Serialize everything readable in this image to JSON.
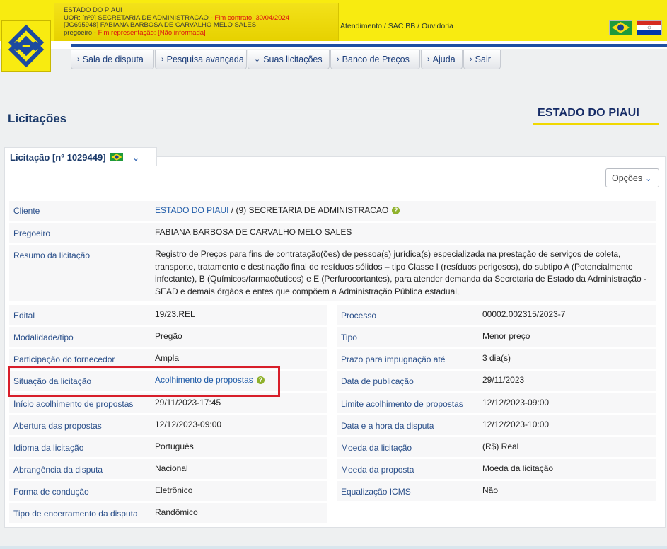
{
  "header": {
    "org_name": "ESTADO DO PIAUI",
    "uor_text": "UOR: [nº9] SECRETARIA DE ADMINISTRACAO - ",
    "contract_end": "Fim contrato: 30/04/2024",
    "user_text": "[JG695948] FABIANA BARBOSA DE CARVALHO MELO SALES",
    "role_text": "pregoeiro - ",
    "role_end": "Fim representação: [Não informada]",
    "service_links": "Atendimento / SAC BB / Ouvidoria",
    "flags": [
      "brazil-flag",
      "paraguay-flag"
    ],
    "brand_color": "#f8eb10",
    "accent_color": "#1e4fa3"
  },
  "nav": {
    "items": [
      {
        "label": "Sala de disputa",
        "icon": "chevron-right-icon"
      },
      {
        "label": "Pesquisa avançada",
        "icon": "chevron-right-icon"
      },
      {
        "label": "Suas licitações",
        "icon": "chevron-down-icon"
      },
      {
        "label": "Banco de Preços",
        "icon": "chevron-right-icon"
      },
      {
        "label": "Ajuda",
        "icon": "chevron-right-icon"
      },
      {
        "label": "Sair",
        "icon": "chevron-right-icon"
      }
    ]
  },
  "page": {
    "title": "Licitações",
    "org_title": "ESTADO DO PIAUI",
    "tab_label": "Licitação [nº 1029449]",
    "options_label": "Opções"
  },
  "details": {
    "cliente": {
      "label": "Cliente",
      "org_link": "ESTADO DO PIAUI",
      "org_rest": " / (9)  SECRETARIA DE ADMINISTRACAO"
    },
    "pregoeiro": {
      "label": "Pregoeiro",
      "value": "FABIANA BARBOSA DE CARVALHO MELO SALES"
    },
    "resumo": {
      "label": "Resumo da licitação",
      "value": "Registro de Preços para fins de contratação(ões) de pessoa(s) jurídica(s) especializada na prestação de serviços de coleta, transporte, tratamento e destinação final de resíduos sólidos – tipo Classe I (resíduos perigosos), do subtipo A (Potencialmente infectante), B (Químicos/farmacêuticos) e E (Perfurocortantes), para atender demanda da Secretaria de Estado da Administração - SEAD e demais órgãos e entes que compõem a Administração Pública estadual,"
    },
    "left": [
      {
        "label": "Edital",
        "value": "19/23.REL"
      },
      {
        "label": "Modalidade/tipo",
        "value": "Pregão"
      },
      {
        "label": "Participação do fornecedor",
        "value": "Ampla"
      },
      {
        "label": "Situação da licitação",
        "value": "Acolhimento de propostas"
      },
      {
        "label": "Início acolhimento de propostas",
        "value": "29/11/2023-17:45"
      },
      {
        "label": "Abertura das propostas",
        "value": "12/12/2023-09:00"
      },
      {
        "label": "Idioma da licitação",
        "value": "Português"
      },
      {
        "label": "Abrangência da disputa",
        "value": "Nacional"
      },
      {
        "label": "Forma de condução",
        "value": "Eletrônico"
      },
      {
        "label": "Tipo de encerramento da disputa",
        "value": "Randômico"
      }
    ],
    "right": [
      {
        "label": "Processo",
        "value": "00002.002315/2023-7"
      },
      {
        "label": "Tipo",
        "value": "Menor preço"
      },
      {
        "label": "Prazo para impugnação até",
        "value": "3 dia(s)"
      },
      {
        "label": "Data de publicação",
        "value": "29/11/2023"
      },
      {
        "label": "Limite acolhimento de propostas",
        "value": "12/12/2023-09:00"
      },
      {
        "label": "Data e a hora da disputa",
        "value": "12/12/2023-10:00"
      },
      {
        "label": "Moeda da licitação",
        "value": "(R$) Real"
      },
      {
        "label": "Moeda da proposta",
        "value": "Moeda da licitação"
      },
      {
        "label": "Equalização ICMS",
        "value": "Não"
      }
    ]
  }
}
